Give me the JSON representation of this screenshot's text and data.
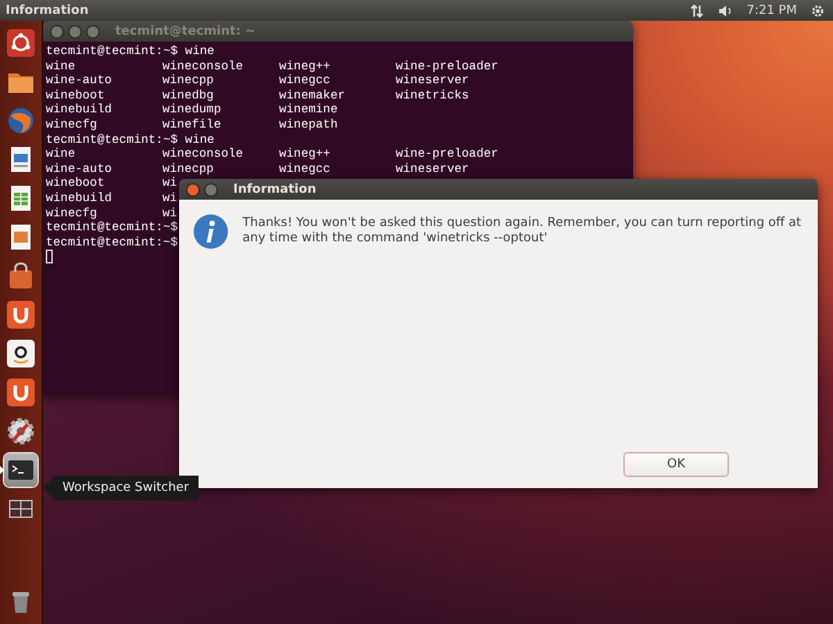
{
  "top_panel": {
    "title": "Information",
    "clock": "7:21 PM"
  },
  "launcher": [
    {
      "kind": "ubuntu",
      "selected": false
    },
    {
      "kind": "files",
      "selected": false
    },
    {
      "kind": "browser",
      "selected": false
    },
    {
      "kind": "writer",
      "selected": false
    },
    {
      "kind": "calc",
      "selected": false
    },
    {
      "kind": "impress",
      "selected": false
    },
    {
      "kind": "store",
      "selected": false
    },
    {
      "kind": "cloud",
      "selected": false
    },
    {
      "kind": "shop",
      "selected": false
    },
    {
      "kind": "cloud",
      "selected": false
    },
    {
      "kind": "settings",
      "selected": false
    },
    {
      "kind": "terminal",
      "selected": true
    },
    {
      "kind": "workspaces",
      "selected": false
    },
    {
      "kind": "trash",
      "selected": false
    }
  ],
  "terminal": {
    "title": "tecmint@tecmint: ~",
    "lines": [
      {
        "kind": "prompt",
        "text": "tecmint@tecmint:~$ wine"
      },
      {
        "kind": "columns",
        "cells": [
          "wine",
          "wineconsole",
          "wineg++",
          "wine-preloader"
        ]
      },
      {
        "kind": "columns",
        "cells": [
          "wine-auto",
          "winecpp",
          "winegcc",
          "wineserver"
        ]
      },
      {
        "kind": "columns",
        "cells": [
          "wineboot",
          "winedbg",
          "winemaker",
          "winetricks"
        ]
      },
      {
        "kind": "columns",
        "cells": [
          "winebuild",
          "winedump",
          "winemine"
        ]
      },
      {
        "kind": "columns",
        "cells": [
          "winecfg",
          "winefile",
          "winepath"
        ]
      },
      {
        "kind": "prompt",
        "text": "tecmint@tecmint:~$ wine"
      },
      {
        "kind": "columns",
        "cells": [
          "wine",
          "wineconsole",
          "wineg++",
          "wine-preloader"
        ]
      },
      {
        "kind": "columns",
        "cells": [
          "wine-auto",
          "winecpp",
          "winegcc",
          "wineserver"
        ]
      },
      {
        "kind": "columns",
        "cells": [
          "wineboot",
          "wi"
        ]
      },
      {
        "kind": "columns",
        "cells": [
          "winebuild",
          "wi"
        ]
      },
      {
        "kind": "columns",
        "cells": [
          "winecfg",
          "wi"
        ]
      },
      {
        "kind": "prompt",
        "text": "tecmint@tecmint:~$"
      },
      {
        "kind": "prompt",
        "text": "tecmint@tecmint:~$"
      },
      {
        "kind": "cursor"
      }
    ]
  },
  "dialog": {
    "title": "Information",
    "message": "Thanks!  You won't be asked this question again.  Remember, you can turn reporting off at any time with the command 'winetricks --optout'",
    "button": "OK"
  },
  "tooltip": {
    "text": "Workspace Switcher"
  }
}
